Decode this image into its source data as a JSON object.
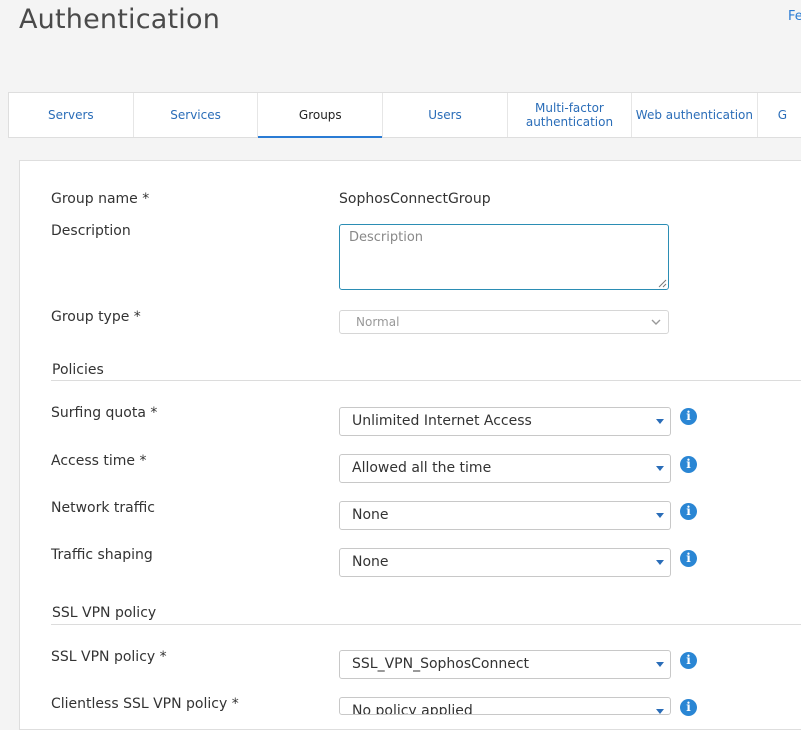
{
  "page": {
    "title": "Authentication",
    "top_link": "Fe"
  },
  "tabs": [
    {
      "label": "Servers",
      "active": false
    },
    {
      "label": "Services",
      "active": false
    },
    {
      "label": "Groups",
      "active": true
    },
    {
      "label": "Users",
      "active": false
    },
    {
      "label": "Multi-factor authentication",
      "active": false
    },
    {
      "label": "Web authentication",
      "active": false
    },
    {
      "label": "G",
      "active": false
    }
  ],
  "form": {
    "group_name": {
      "label": "Group name *",
      "value": "SophosConnectGroup"
    },
    "description": {
      "label": "Description",
      "value": "",
      "placeholder": "Description"
    },
    "group_type": {
      "label": "Group type *",
      "value": "Normal"
    }
  },
  "policies": {
    "section_title": "Policies",
    "surfing_quota": {
      "label": "Surfing quota *",
      "value": "Unlimited Internet Access"
    },
    "access_time": {
      "label": "Access time *",
      "value": "Allowed all the time"
    },
    "network_traffic": {
      "label": "Network traffic",
      "value": "None"
    },
    "traffic_shaping": {
      "label": "Traffic shaping",
      "value": "None"
    }
  },
  "ssl_vpn": {
    "section_title": "SSL VPN policy",
    "ssl_vpn_policy": {
      "label": "SSL VPN policy *",
      "value": "SSL_VPN_SophosConnect"
    },
    "clientless_policy": {
      "label": "Clientless SSL VPN policy *",
      "value": "No policy applied"
    }
  },
  "icons": {
    "info": "i"
  },
  "colors": {
    "accent": "#2a7bd4",
    "info_icon": "#2a86d4",
    "focus_border": "#2b8db4",
    "tab_text": "#2a6db8"
  }
}
